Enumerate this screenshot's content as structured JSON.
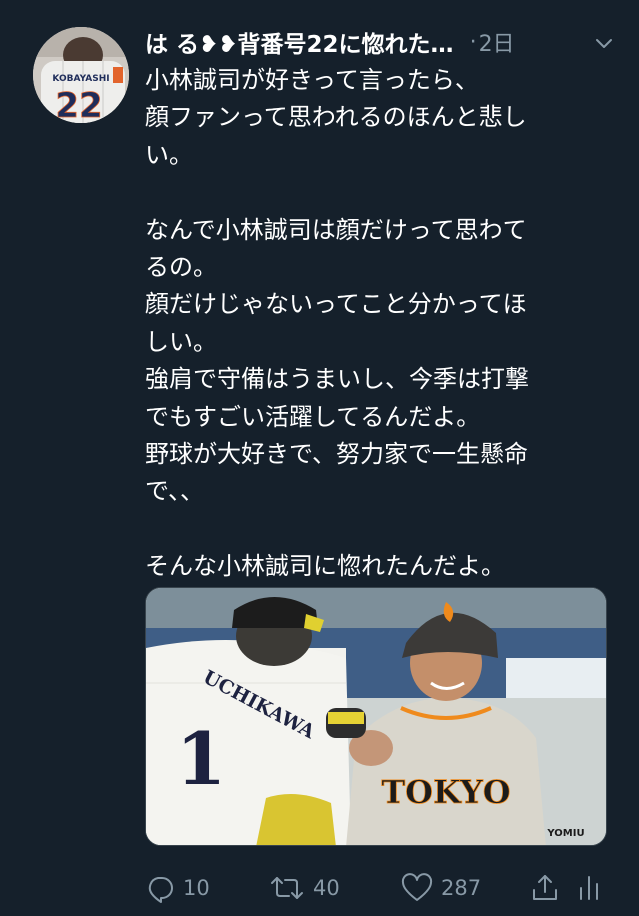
{
  "tweet": {
    "username": "は る❥❥背番号22に惚れた…",
    "separator": "·",
    "time": "2日",
    "lines": [
      "小林誠司が好きって言ったら、",
      "顔ファンって思われるのほんと悲し",
      "い。",
      "",
      "なんで小林誠司は顔だけって思わて",
      "るの。",
      "顔だけじゃないってこと分かってほ",
      "しい。",
      "強肩で守備はうまいし、今季は打撃",
      "でもすごい活躍してるんだよ。",
      "野球が大好きで、努力家で一生懸命",
      "で、、",
      "",
      "そんな小林誠司に惚れたんだよ。"
    ],
    "avatar": {
      "jersey_name": "KOBAYASHI",
      "jersey_number": "22"
    },
    "media": {
      "left_player_name": "UCHIKAWA",
      "left_player_number": "1",
      "right_player_jersey": "TOKYO",
      "right_player_sleeve": "YOMIU"
    }
  },
  "actions": {
    "reply_count": "10",
    "retweet_count": "40",
    "like_count": "287"
  },
  "colors": {
    "background": "#15202b",
    "text": "#ffffff",
    "secondary": "#8899a6"
  },
  "icons": [
    "chevron-down-icon",
    "reply-icon",
    "retweet-icon",
    "like-icon",
    "share-icon",
    "analytics-icon"
  ]
}
